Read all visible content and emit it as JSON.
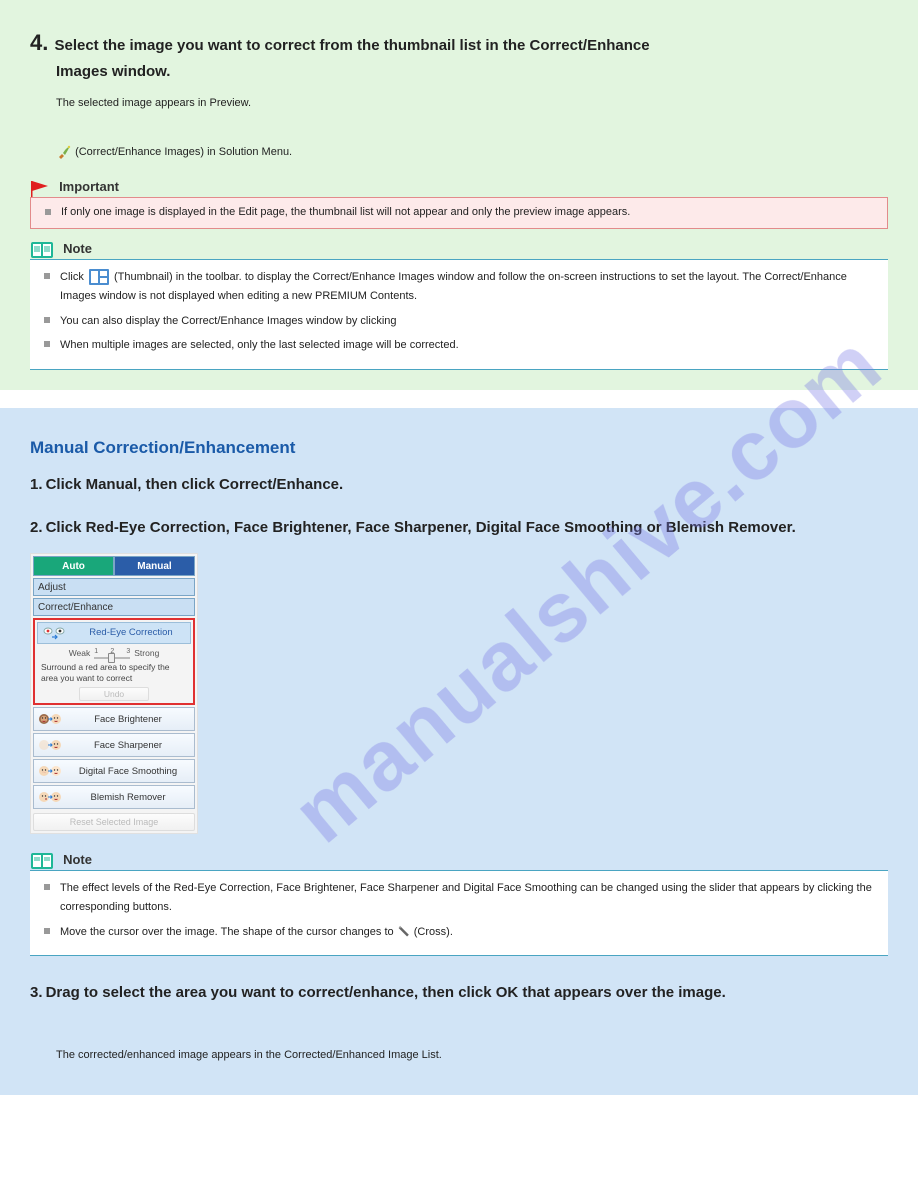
{
  "watermark": "manualshive.com",
  "green": {
    "stepnum": "4.",
    "step_title_1": "Select the image you want to correct from the thumbnail list in the Correct/Enhance",
    "step_title_2": "Images window.",
    "step_body": "The selected image appears in Preview.",
    "correct_icon_text": " (Correct/Enhance Images) in Solution Menu.",
    "important_label": "Important",
    "important_text": "If only one image is displayed in the Edit page, the thumbnail list will not appear and only the preview image appears.",
    "note_label": "Note",
    "thumb_icon_hint": " (Thumbnail) in the toolbar.",
    "note1_prefix": "Click ",
    "note1_suffix": " to display the Correct/Enhance Images window and follow the on-screen instructions to set the layout. The Correct/Enhance Images window is not displayed when editing a new PREMIUM Contents.",
    "note2": "You can also display the Correct/Enhance Images window by clicking ",
    "note3": "When multiple images are selected, only the last selected image will be corrected."
  },
  "blue": {
    "heading": "Manual Correction/Enhancement",
    "item1_label": "1.",
    "item1_body": "Click Manual, then click Correct/Enhance.",
    "item2_label": "2.",
    "item2_body1": "Click Red-Eye Correction, Face Brightener, Face Sharpener, Digital Face Smoothing or Blemish Remover.",
    "panel": {
      "tab_auto": "Auto",
      "tab_manual": "Manual",
      "sub_adjust": "Adjust",
      "sub_correct": "Correct/Enhance",
      "redeye": "Red-Eye Correction",
      "weak": "Weak",
      "strong": "Strong",
      "n1": "1",
      "n2": "2",
      "n3": "3",
      "redeye_desc": "Surround a red area to specify the area you want to correct",
      "undo": "Undo",
      "opt_brightener": "Face Brightener",
      "opt_sharpener": "Face Sharpener",
      "opt_smoothing": "Digital Face Smoothing",
      "opt_blemish": "Blemish Remover",
      "reset": "Reset Selected Image"
    },
    "note_label": "Note",
    "note1": "The effect levels of the Red-Eye Correction, Face Brightener, Face Sharpener and Digital Face Smoothing can be changed using the slider that appears by clicking the corresponding buttons.",
    "note2_prefix": "Move the cursor over the image. The shape of the cursor changes to ",
    "note2_suffix": " (Cross).",
    "item3_label": "3.",
    "item3_body": "Drag to select the area you want to correct/enhance, then click OK that appears over the image.",
    "trailing": "The corrected/enhanced image appears in the Corrected/Enhanced Image List."
  }
}
